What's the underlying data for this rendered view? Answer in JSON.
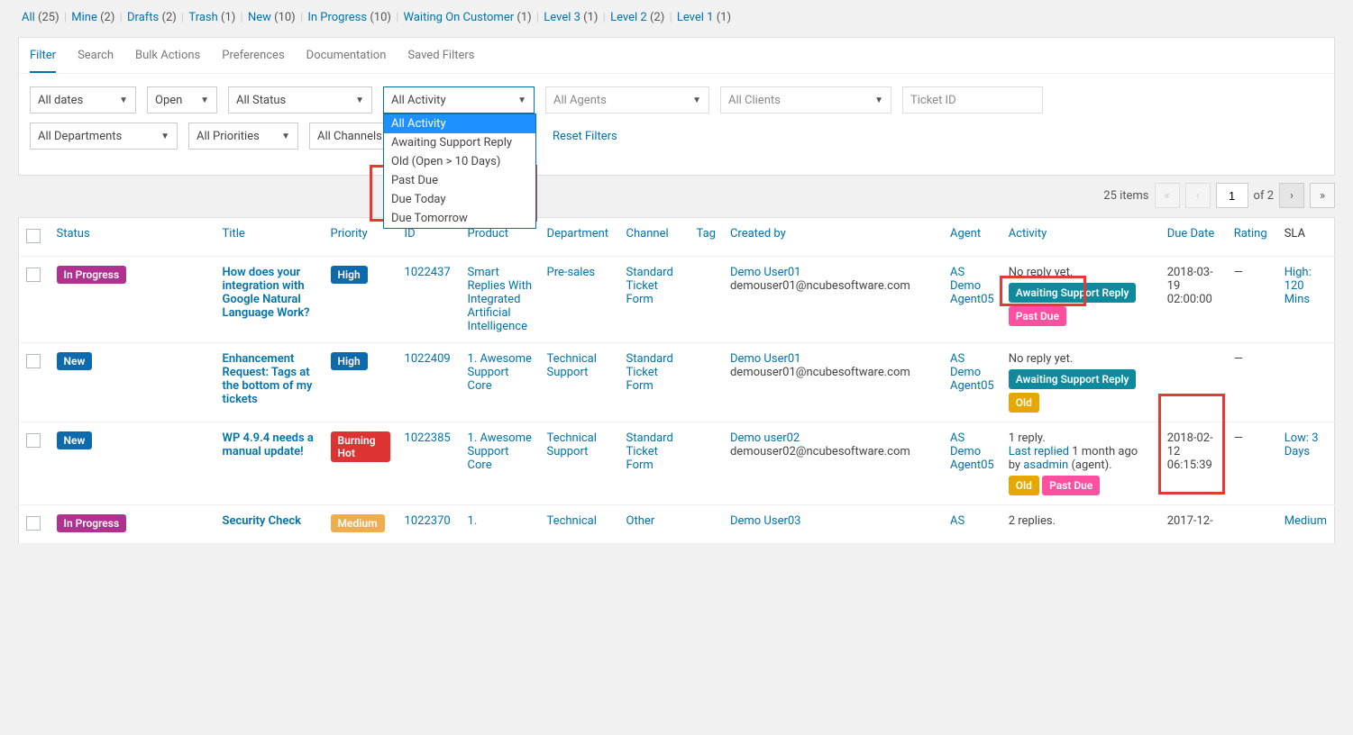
{
  "status_tabs": [
    {
      "label": "All",
      "count": "(25)"
    },
    {
      "label": "Mine",
      "count": "(2)"
    },
    {
      "label": "Drafts",
      "count": "(2)"
    },
    {
      "label": "Trash",
      "count": "(1)"
    },
    {
      "label": "New",
      "count": "(10)"
    },
    {
      "label": "In Progress",
      "count": "(10)"
    },
    {
      "label": "Waiting On Customer",
      "count": "(1)"
    },
    {
      "label": "Level 3",
      "count": "(1)"
    },
    {
      "label": "Level 2",
      "count": "(2)"
    },
    {
      "label": "Level 1",
      "count": "(1)"
    }
  ],
  "tabs": {
    "filter": "Filter",
    "search": "Search",
    "bulk": "Bulk Actions",
    "prefs": "Preferences",
    "docs": "Documentation",
    "saved": "Saved Filters"
  },
  "filters": {
    "dates": "All dates",
    "open": "Open",
    "status": "All Status",
    "activity": "All Activity",
    "agents": "All Agents",
    "clients": "All Clients",
    "ticketid": "Ticket ID",
    "dept": "All Departments",
    "prio": "All Priorities",
    "chan": "All Channels",
    "reset": "Reset Filters"
  },
  "activity_options": [
    "All Activity",
    "Awaiting Support Reply",
    "Old (Open > 10 Days)",
    "Past Due",
    "Due Today",
    "Due Tomorrow"
  ],
  "pager": {
    "items": "25 items",
    "page": "1",
    "of": "of 2"
  },
  "cols": {
    "status": "Status",
    "title": "Title",
    "priority": "Priority",
    "id": "ID",
    "product": "Product",
    "department": "Department",
    "channel": "Channel",
    "tag": "Tag",
    "created": "Created by",
    "agent": "Agent",
    "activity": "Activity",
    "due": "Due Date",
    "rating": "Rating",
    "sla": "SLA"
  },
  "rows": [
    {
      "status": {
        "label": "In Progress",
        "class": "b-inprog"
      },
      "title": "How does your integration with Google Natural Language Work?",
      "priority": {
        "label": "High",
        "class": "b-high"
      },
      "id": "1022437",
      "product": "Smart Replies With Integrated Artificial Intelligence",
      "department": "Pre-sales",
      "channel": "Standard Ticket Form",
      "created_name": "Demo User01",
      "created_email": "demouser01@ncubesoftware.com",
      "agent": "AS Demo Agent05",
      "activity_text": "No reply yet.",
      "activity_badges": [
        {
          "label": "Awaiting Support Reply",
          "class": "b-await"
        },
        {
          "label": "Past Due",
          "class": "b-past"
        }
      ],
      "due": "2018-03-19 02:00:00",
      "rating": "—",
      "sla": "High: 120 Mins",
      "due_highlight": false,
      "past_highlight": true
    },
    {
      "status": {
        "label": "New",
        "class": "b-new"
      },
      "title": "Enhancement Request: Tags at the bottom of my tickets",
      "priority": {
        "label": "High",
        "class": "b-high"
      },
      "id": "1022409",
      "product": "1. Awesome Support Core",
      "department": "Technical Support",
      "channel": "Standard Ticket Form",
      "created_name": "Demo User01",
      "created_email": "demouser01@ncubesoftware.com",
      "agent": "AS Demo Agent05",
      "activity_text": "No reply yet.",
      "activity_badges": [
        {
          "label": "Awaiting Support Reply",
          "class": "b-await"
        },
        {
          "label": "Old",
          "class": "b-old"
        }
      ],
      "due": "",
      "rating": "—",
      "sla": "",
      "due_highlight": false,
      "past_highlight": false
    },
    {
      "status": {
        "label": "New",
        "class": "b-new"
      },
      "title": "WP 4.9.4 needs a manual update!",
      "priority": {
        "label": "Burning Hot",
        "class": "b-burn"
      },
      "id": "1022385",
      "product": "1. Awesome Support Core",
      "department": "Technical Support",
      "channel": "Standard Ticket Form",
      "created_name": "Demo user02",
      "created_email": "demouser02@ncubesoftware.com",
      "agent": "AS Demo Agent05",
      "activity_text": "1 reply.",
      "activity_line2_a": "Last replied",
      "activity_line2_b": " 1 month ago by ",
      "activity_line2_c": "asadmin",
      "activity_line2_d": " (agent).",
      "activity_badges": [
        {
          "label": "Old",
          "class": "b-old"
        },
        {
          "label": "Past Due",
          "class": "b-past"
        }
      ],
      "due": "2018-02-12 06:15:39",
      "rating": "—",
      "sla": "Low: 3 Days",
      "due_highlight": true,
      "past_highlight": false
    },
    {
      "status": {
        "label": "In Progress",
        "class": "b-inprog"
      },
      "title": "Security Check",
      "priority": {
        "label": "Medium",
        "class": "b-medium"
      },
      "id": "1022370",
      "product": "1.",
      "department": "Technical",
      "channel": "Other",
      "created_name": "Demo User03",
      "created_email": "",
      "agent": "AS",
      "activity_text": "2 replies.",
      "activity_badges": [],
      "due": "2017-12-",
      "rating": "",
      "sla": "Medium",
      "due_highlight": false,
      "past_highlight": false
    }
  ]
}
